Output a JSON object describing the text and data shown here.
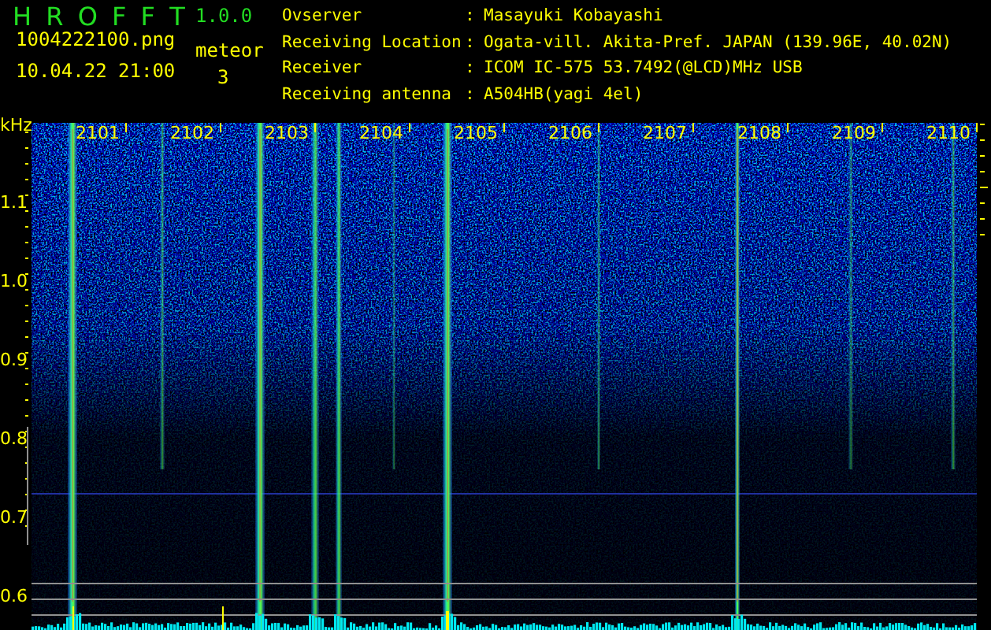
{
  "app": {
    "title": "H R O F F T",
    "version": "1.0.0",
    "file_name": "1004222100.png",
    "date_time": "10.04.22 21:00",
    "meteor_label": "meteor",
    "meteor_count": "3"
  },
  "info": [
    {
      "label": "Ovserver",
      "sep": ":",
      "value": "Masayuki Kobayashi"
    },
    {
      "label": "Receiving Location",
      "sep": ":",
      "value": "Ogata-vill. Akita-Pref. JAPAN (139.96E, 40.02N)"
    },
    {
      "label": "Receiver",
      "sep": ":",
      "value": "ICOM IC-575 53.7492(@LCD)MHz USB"
    },
    {
      "label": "Receiving antenna",
      "sep": ":",
      "value": "A504HB(yagi 4el)"
    }
  ],
  "spectrogram": {
    "unit": "kHz",
    "y_labels": [
      "1.1",
      "1.0",
      "0.9",
      "0.8",
      "0.7",
      "0.6"
    ],
    "x_labels": [
      "2101",
      "2102",
      "2103",
      "2104",
      "2105",
      "2106",
      "2107",
      "2108",
      "2109",
      "2110"
    ]
  }
}
